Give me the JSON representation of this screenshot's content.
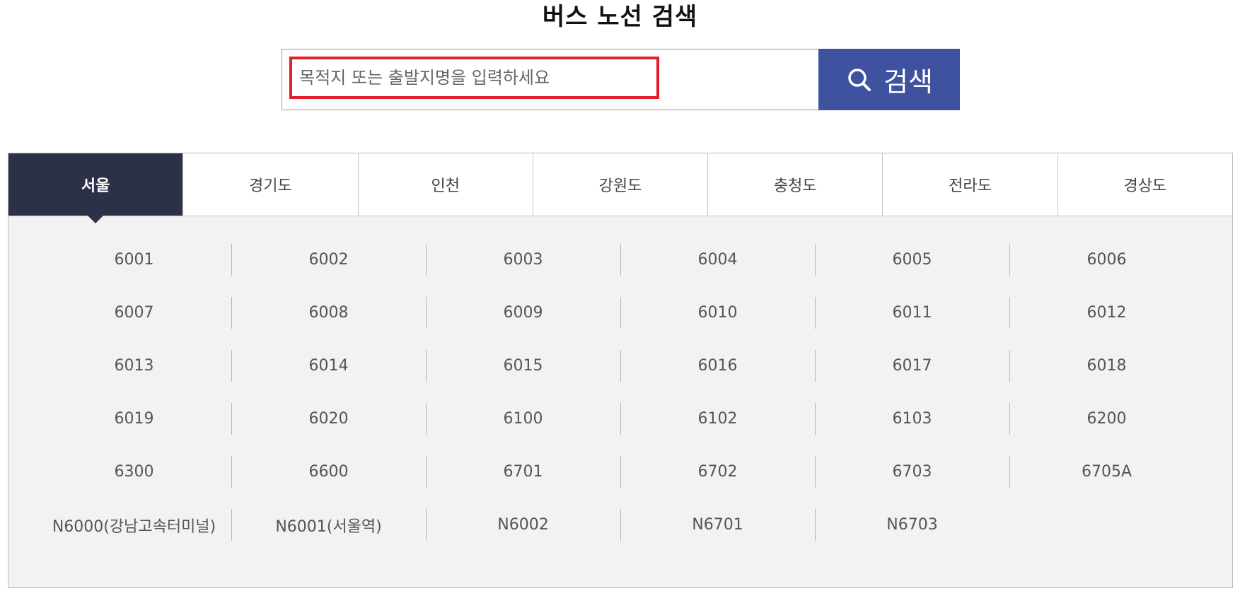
{
  "page": {
    "title": "버스 노선 검색"
  },
  "search": {
    "placeholder": "목적지 또는 출발지명을 입력하세요",
    "value": "",
    "button_label": "검색",
    "button_color": "#3f52a0",
    "highlight_color": "#e0202a",
    "icon": "search-icon"
  },
  "tabs": [
    {
      "label": "서울",
      "active": true
    },
    {
      "label": "경기도",
      "active": false
    },
    {
      "label": "인천",
      "active": false
    },
    {
      "label": "강원도",
      "active": false
    },
    {
      "label": "충청도",
      "active": false
    },
    {
      "label": "전라도",
      "active": false
    },
    {
      "label": "경상도",
      "active": false
    }
  ],
  "active_tab_color": "#2d3148",
  "routes": [
    "6001",
    "6002",
    "6003",
    "6004",
    "6005",
    "6006",
    "6007",
    "6008",
    "6009",
    "6010",
    "6011",
    "6012",
    "6013",
    "6014",
    "6015",
    "6016",
    "6017",
    "6018",
    "6019",
    "6020",
    "6100",
    "6102",
    "6103",
    "6200",
    "6300",
    "6600",
    "6701",
    "6702",
    "6703",
    "6705A",
    "N6000(강남고속터미널)",
    "N6001(서울역)",
    "N6002",
    "N6701",
    "N6703"
  ]
}
